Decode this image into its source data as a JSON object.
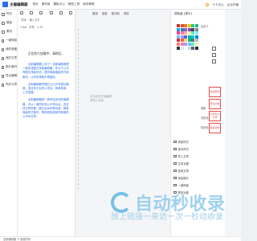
{
  "header": {
    "app_title": "主编编辑器",
    "nav": [
      "首页",
      "素材库",
      "模板中心",
      "微信工具",
      "新手教程"
    ],
    "right": [
      "个人中心",
      "企业开通"
    ],
    "bell_icon": "bell-icon"
  },
  "rail": {
    "items": [
      {
        "label": "样式",
        "icon": "style-icon"
      },
      {
        "label": "模板",
        "icon": "template-icon"
      },
      {
        "label": "素材",
        "icon": "material-icon"
      },
      {
        "label": "一键排版",
        "icon": "format-icon"
      },
      {
        "label": "我的收藏",
        "icon": "star-icon"
      },
      {
        "label": "我的文章",
        "icon": "doc-icon"
      },
      {
        "label": "图片素材",
        "icon": "image-icon"
      },
      {
        "label": "导出编辑",
        "icon": "export-icon"
      },
      {
        "label": "同步文章",
        "icon": "sync-icon"
      }
    ]
  },
  "col2": {
    "note": "字体： 输入文字",
    "toolbar": [
      "17px",
      "字号",
      "1.75"
    ],
    "greeting": "正在努力加载中，请稍后。",
    "paragraphs": [
      "全新编辑器上线了！全新编辑器是一款在线图文排版编辑器，专注于公众号图文排版样式，提供海量模板样式和素材，让你的排版不再困扰。",
      "全新编辑器凭借它让公众号更加美观，支持多平台导入导出，简单易用，上手快捷。",
      "全新编辑器是一款简洁实用的编辑器，可以一键同步到公众号后台，还支持文章采集、图片加水印等功能，拥有海量样式素材，帮助你轻松制作精美的公众号文章。"
    ]
  },
  "canvas": {
    "toolbar": [
      "撤销",
      "重做",
      "格式刷",
      "清除"
    ],
    "hint": [
      "点击此处开始编辑",
      "或拖入内容"
    ]
  },
  "panel": {
    "title": "调色盘 [提示]",
    "sub_label": "自定义",
    "colors": [
      "#c0392b",
      "#e74c3c",
      "#e67e22",
      "#f1c40f",
      "#2ecc71",
      "#1abc9c",
      "#3498db",
      "#2980b9",
      "#9b59b6",
      "#8e44ad",
      "#34495e",
      "#7f8c8d",
      "#e84393",
      "#fd79a8",
      "#fab1a0",
      "#ffeaa7",
      "#55efc4",
      "#81ecec",
      "#74b9ff",
      "#a29bfe",
      "#6c5ce7",
      "#00b894",
      "#00cec9",
      "#0984e3",
      "#d63031",
      "#e17055",
      "#fdcb6e",
      "#00b894",
      "#636e72",
      "#b2bec3",
      "#ff7675",
      "#fd79a8",
      "#a29bfe",
      "#74b9ff",
      "#55efc4",
      "#ffeaa7",
      "#2d3436",
      "#dfe6e9",
      "#ffffff",
      "#c8d6e5",
      "#576574",
      "#222f3e"
    ],
    "red_buttons": [
      "快速保存",
      "导出文章",
      "同步到公众号",
      "更多操作"
    ],
    "side_tools": [
      "清除样式",
      "保存样式",
      "导入文章",
      "生成长图",
      "复制文章",
      "添加图片",
      "一键排版",
      "更多功能"
    ],
    "mini_labels": [
      "透明",
      "背景色",
      "前景色"
    ]
  },
  "watermark": {
    "brand": "自动秒收录",
    "tagline": "放上链接一来访一次一秒动收录"
  },
  "footer": {
    "text": "全新编辑器 © 版权所有"
  }
}
